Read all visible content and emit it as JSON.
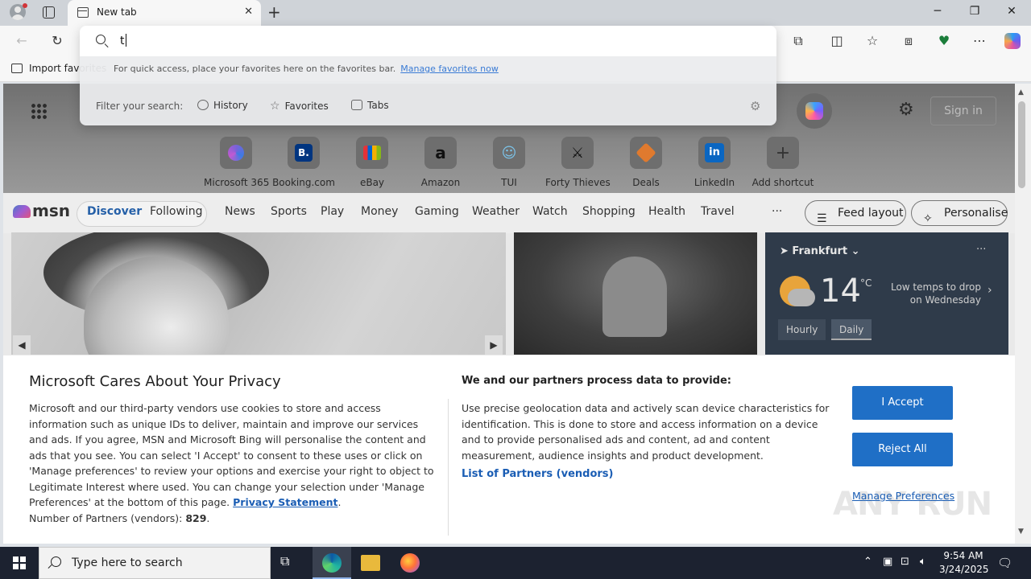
{
  "browser": {
    "tab_title": "New tab",
    "address_value": "t",
    "favorites_bar": {
      "import_label": "Import favorites"
    }
  },
  "address_dropdown": {
    "fav_hint": "For quick access, place your favorites here on the favorites bar.",
    "fav_hint_link": "Manage favorites now",
    "filter_label": "Filter your search:",
    "filters": [
      "History",
      "Favorites",
      "Tabs"
    ]
  },
  "newtab": {
    "signin_label": "Sign in",
    "shortcuts": [
      {
        "label": "Microsoft 365",
        "icon": "m365-icon",
        "color": "#6b5fc7"
      },
      {
        "label": "Booking.com",
        "icon": "booking-icon",
        "color": "#003580"
      },
      {
        "label": "eBay",
        "icon": "ebay-icon",
        "color": "#e53238"
      },
      {
        "label": "Amazon",
        "icon": "amazon-icon",
        "color": "#222222"
      },
      {
        "label": "TUI",
        "icon": "tui-icon",
        "color": "#7cc4ea"
      },
      {
        "label": "Forty Thieves",
        "icon": "forty-thieves-icon",
        "color": "#222222"
      },
      {
        "label": "Deals",
        "icon": "deals-icon",
        "color": "#e07a2e"
      },
      {
        "label": "LinkedIn",
        "icon": "linkedin-icon",
        "color": "#0a66c2"
      },
      {
        "label": "Add shortcut",
        "icon": "plus-icon",
        "color": "#444444"
      }
    ]
  },
  "msn": {
    "logo": "msn",
    "pill_tabs": [
      "Discover",
      "Following"
    ],
    "nav": [
      "News",
      "Sports",
      "Play",
      "Money",
      "Gaming",
      "Weather",
      "Watch",
      "Shopping",
      "Health",
      "Travel"
    ],
    "more": "···",
    "feed_layout": "Feed layout",
    "personalise": "Personalise"
  },
  "weather": {
    "location": "Frankfurt",
    "temp": "14",
    "unit": "°C",
    "note": "Low temps to drop on Wednesday",
    "tabs": [
      "Hourly",
      "Daily"
    ],
    "selected_tab": "Daily"
  },
  "privacy": {
    "title": "Microsoft Cares About Your Privacy",
    "body": "Microsoft and our third-party vendors use cookies to store and access information such as unique IDs to deliver, maintain and improve our services and ads. If you agree, MSN and Microsoft Bing will personalise the content and ads that you see. You can select 'I Accept' to consent to these uses or click on 'Manage preferences' to review your options and exercise your right to object to Legitimate Interest where used.  You can change your selection under 'Manage Preferences' at the bottom of this page.",
    "privacy_link": "Privacy Statement",
    "partners_prefix": "Number of Partners (vendors):",
    "partners_count": "829",
    "right_heading": "We and our partners process data to provide:",
    "right_body": "Use precise geolocation data and actively scan device characteristics for identification. This is done to store and access information on a device and to provide personalised ads and content, ad and content measurement, audience insights and product development.",
    "partners_link": "List of Partners (vendors)",
    "accept": "I Accept",
    "reject": "Reject All",
    "manage": "Manage Preferences"
  },
  "watermark": "ANY RUN",
  "taskbar": {
    "search_placeholder": "Type here to search",
    "time": "9:54 AM",
    "date": "3/24/2025"
  }
}
